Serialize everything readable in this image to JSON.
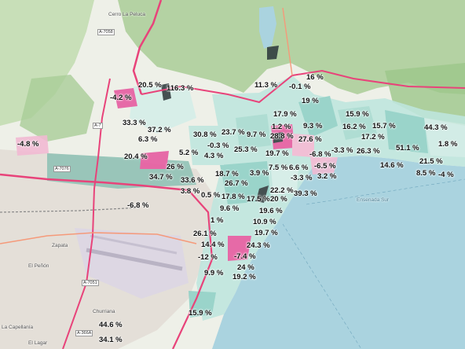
{
  "colors": {
    "sea": "#aad3df",
    "land": "#eef0e8",
    "forest": "#a9cd97",
    "forest_dark": "#9cc78a",
    "urban": "#e4dfd8",
    "motorway": "#e8437a",
    "trunk": "#f59a7a",
    "choropleth_high": "#e6589f",
    "choropleth_mid": "#8fd1c6",
    "choropleth_low": "#d4eee9",
    "choropleth_neg": "#f2b9d3",
    "choropleth_dark": "#2e3a3d"
  },
  "percentage_labels": [
    {
      "id": "p1",
      "text": "20.5 %"
    },
    {
      "id": "p2",
      "text": "116.3 %"
    },
    {
      "id": "p3",
      "text": "-4.2 %"
    },
    {
      "id": "p4",
      "text": "11.3 %"
    },
    {
      "id": "p5",
      "text": "-0.1 %"
    },
    {
      "id": "p6",
      "text": "16 %"
    },
    {
      "id": "p7",
      "text": "19 %"
    },
    {
      "id": "p8",
      "text": "33.3 %"
    },
    {
      "id": "p9",
      "text": "37.2 %"
    },
    {
      "id": "p10",
      "text": "6.3 %"
    },
    {
      "id": "p11",
      "text": "17.9 %"
    },
    {
      "id": "p12",
      "text": "15.9 %"
    },
    {
      "id": "p13",
      "text": "1.2 %"
    },
    {
      "id": "p14",
      "text": "9.3 %"
    },
    {
      "id": "p15",
      "text": "16.2 %"
    },
    {
      "id": "p16",
      "text": "15.7 %"
    },
    {
      "id": "p17",
      "text": "44.3 %"
    },
    {
      "id": "p18",
      "text": "-4.8 %"
    },
    {
      "id": "p19",
      "text": "30.8 %"
    },
    {
      "id": "p20",
      "text": "23.7 %"
    },
    {
      "id": "p21",
      "text": "9.7 %"
    },
    {
      "id": "p22",
      "text": "28.8 %"
    },
    {
      "id": "p23",
      "text": "27.6 %"
    },
    {
      "id": "p24",
      "text": "17.2 %"
    },
    {
      "id": "p25",
      "text": "-0.3 %"
    },
    {
      "id": "p26",
      "text": "1.8 %"
    },
    {
      "id": "p27",
      "text": "5.2 %"
    },
    {
      "id": "p28",
      "text": "25.3 %"
    },
    {
      "id": "p29",
      "text": "19.7 %"
    },
    {
      "id": "p30",
      "text": "-3.3 %"
    },
    {
      "id": "p31",
      "text": "26.3 %"
    },
    {
      "id": "p32",
      "text": "51.1 %"
    },
    {
      "id": "p33",
      "text": "20.4 %"
    },
    {
      "id": "p34",
      "text": "4.3 %"
    },
    {
      "id": "p35",
      "text": "-6.8 %"
    },
    {
      "id": "p36",
      "text": "21.5 %"
    },
    {
      "id": "p37",
      "text": "26 %"
    },
    {
      "id": "p38",
      "text": "7.5 %"
    },
    {
      "id": "p39",
      "text": "6.6 %"
    },
    {
      "id": "p40",
      "text": "-6.5 %"
    },
    {
      "id": "p41",
      "text": "14.6 %"
    },
    {
      "id": "p42",
      "text": "8.5 %"
    },
    {
      "id": "p43",
      "text": "-4 %"
    },
    {
      "id": "p44",
      "text": "34.7 %"
    },
    {
      "id": "p45",
      "text": "18.7 %"
    },
    {
      "id": "p46",
      "text": "3.9 %"
    },
    {
      "id": "p47",
      "text": "-3.3 %"
    },
    {
      "id": "p48",
      "text": "3.2 %"
    },
    {
      "id": "p49",
      "text": "33.6 %"
    },
    {
      "id": "p50",
      "text": "26.7 %"
    },
    {
      "id": "p51",
      "text": "22.2 %"
    },
    {
      "id": "p52",
      "text": "3.8 %"
    },
    {
      "id": "p53",
      "text": "0.5 %"
    },
    {
      "id": "p54",
      "text": "39.3 %"
    },
    {
      "id": "p55",
      "text": "17.8 %"
    },
    {
      "id": "p56",
      "text": "17.5 %"
    },
    {
      "id": "p57",
      "text": "20 %"
    },
    {
      "id": "p58",
      "text": "9.6 %"
    },
    {
      "id": "p59",
      "text": "-6.8 %"
    },
    {
      "id": "p60",
      "text": "19.6 %"
    },
    {
      "id": "p61",
      "text": "1 %"
    },
    {
      "id": "p62",
      "text": "10.9 %"
    },
    {
      "id": "p63",
      "text": "26.1 %"
    },
    {
      "id": "p64",
      "text": "19.7 %"
    },
    {
      "id": "p65",
      "text": "14.4 %"
    },
    {
      "id": "p66",
      "text": "24.3 %"
    },
    {
      "id": "p67",
      "text": "-12 %"
    },
    {
      "id": "p68",
      "text": "-7.4 %"
    },
    {
      "id": "p69",
      "text": "24 %"
    },
    {
      "id": "p70",
      "text": "9.9 %"
    },
    {
      "id": "p71",
      "text": "19.2 %"
    },
    {
      "id": "p72",
      "text": "15.9 %"
    },
    {
      "id": "p73",
      "text": "44.6 %"
    },
    {
      "id": "p74",
      "text": "34.1 %"
    }
  ],
  "place_labels": [
    {
      "id": "pl1",
      "text": "Cerro La Peluca"
    },
    {
      "id": "pl2",
      "text": "Zapata"
    },
    {
      "id": "pl3",
      "text": "El Peñón"
    },
    {
      "id": "pl4",
      "text": "Churriana"
    },
    {
      "id": "pl5",
      "text": "La Capellanía"
    },
    {
      "id": "pl6",
      "text": "El Lagar"
    },
    {
      "id": "pl7",
      "text": "Ensenada Sur"
    }
  ],
  "road_refs": [
    {
      "id": "r1",
      "text": "A-7058"
    },
    {
      "id": "r2",
      "text": "A-7"
    },
    {
      "id": "r3",
      "text": "A-7076"
    },
    {
      "id": "r4",
      "text": "A-7051"
    },
    {
      "id": "r5",
      "text": "A-366A"
    }
  ]
}
